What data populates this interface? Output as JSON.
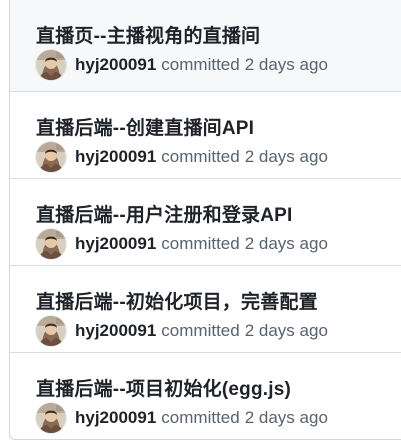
{
  "commits": [
    {
      "title": "直播页--主播视角的直播间",
      "author": "hyj200091",
      "action": "committed",
      "time": "2 days ago"
    },
    {
      "title": "直播后端--创建直播间API",
      "author": "hyj200091",
      "action": "committed",
      "time": "2 days ago"
    },
    {
      "title": "直播后端--用户注册和登录API",
      "author": "hyj200091",
      "action": "committed",
      "time": "2 days ago"
    },
    {
      "title": "直播后端--初始化项目，完善配置",
      "author": "hyj200091",
      "action": "committed",
      "time": "2 days ago"
    },
    {
      "title": "直播后端--项目初始化(egg.js)",
      "author": "hyj200091",
      "action": "committed",
      "time": "2 days ago"
    }
  ],
  "colors": {
    "title": "#1f2328",
    "muted": "#59636e",
    "border": "#d0d7de",
    "hover_bg": "#f6f8fa"
  },
  "icons": {
    "avatar": "user-avatar-icon"
  }
}
